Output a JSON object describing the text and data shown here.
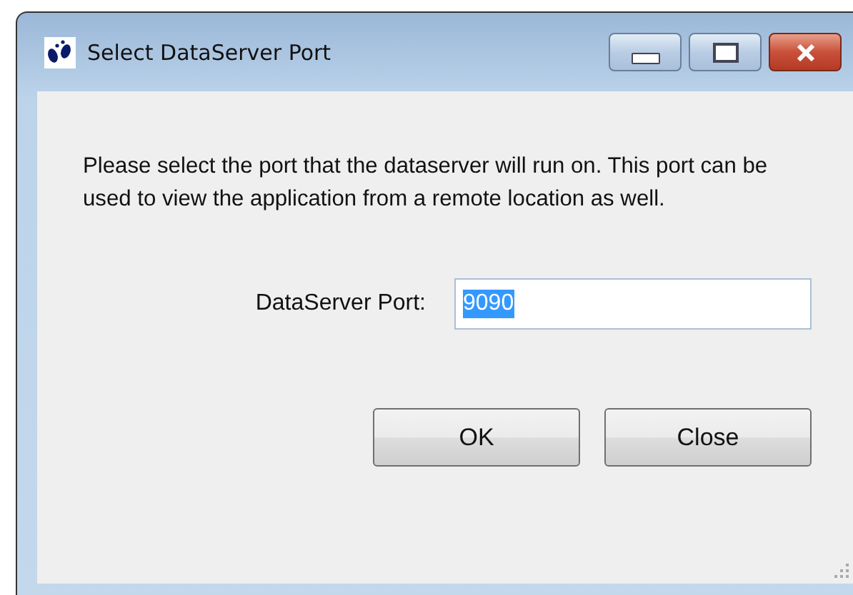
{
  "window": {
    "title": "Select DataServer Port",
    "controls": [
      {
        "kind": "minimize"
      },
      {
        "kind": "maximize"
      },
      {
        "kind": "close"
      }
    ]
  },
  "message": "Please select the port that the dataserver will run on. This port can be used to view the application from a remote location as well.",
  "port_field": {
    "label": "DataServer Port:",
    "value": "9090",
    "text_selected": true
  },
  "buttons": [
    {
      "label": "OK"
    },
    {
      "label": "Close"
    }
  ]
}
